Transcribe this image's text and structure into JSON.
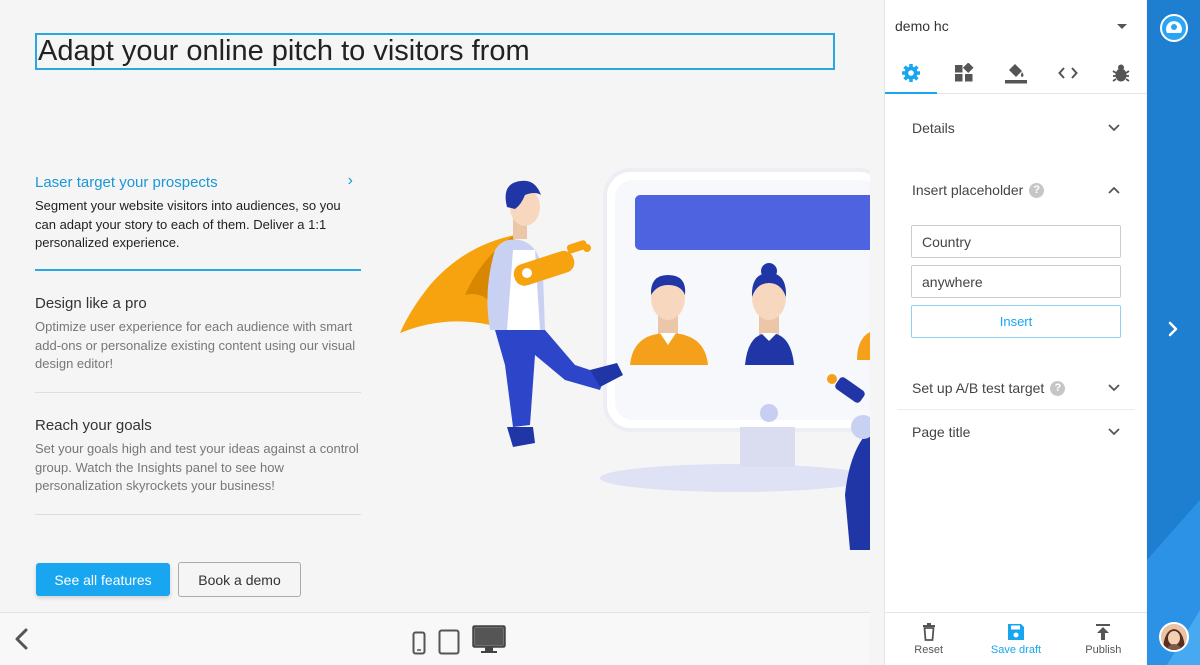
{
  "canvas": {
    "headline": "Adapt your online pitch to visitors from",
    "features": [
      {
        "title": "Laser target your prospects",
        "text": "Segment your website visitors into audiences, so you can adapt your story to each of them. Deliver a 1:1 personalized experience."
      },
      {
        "title": "Design like a pro",
        "text": "Optimize user experience for each audience with smart add-ons or personalize existing content using our visual design editor!"
      },
      {
        "title": "Reach your goals",
        "text": "Set your goals high and test your ideas against a control group. Watch the Insights panel to see how personalization skyrockets your business!"
      }
    ],
    "primary_button": "See all features",
    "secondary_button": "Book a demo"
  },
  "panel": {
    "site_name": "demo hc",
    "sections": {
      "details": "Details",
      "insert_placeholder": "Insert placeholder",
      "field_value": "Country",
      "fallback_value": "anywhere",
      "insert_button": "Insert",
      "ab_test": "Set up A/B test target",
      "page_title": "Page title"
    },
    "footer": {
      "reset": "Reset",
      "save_draft": "Save draft",
      "publish": "Publish"
    }
  },
  "colors": {
    "accent": "#17a6ef",
    "brand_strip": "#1e7fd0"
  }
}
